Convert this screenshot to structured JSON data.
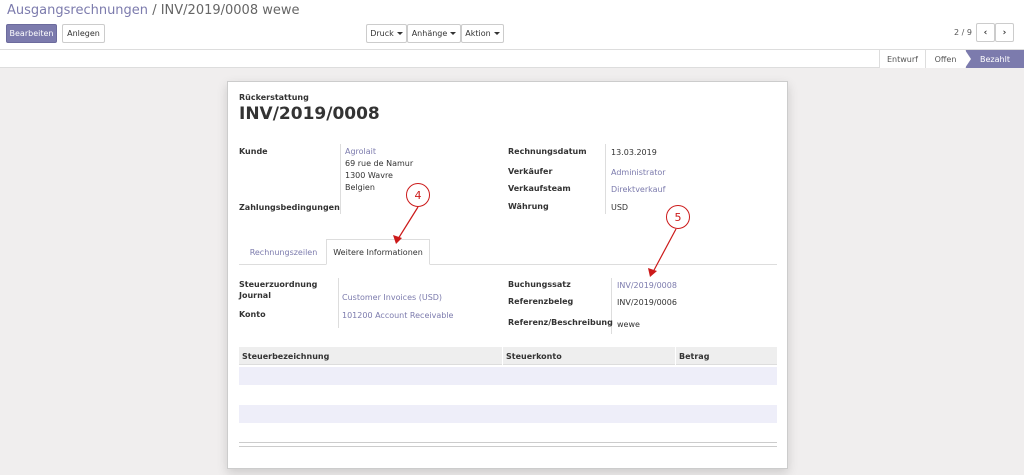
{
  "breadcrumb": {
    "parent": "Ausgangsrechnungen",
    "separator": "/",
    "current": "INV/2019/0008 wewe"
  },
  "toolbar": {
    "edit_label": "Bearbeiten",
    "create_label": "Anlegen",
    "print_label": "Druck",
    "attachments_label": "Anhänge",
    "action_label": "Aktion"
  },
  "pager": {
    "value": "2 / 9"
  },
  "statusbar": {
    "stages": [
      "Entwurf",
      "Offen",
      "Bezahlt"
    ],
    "active": "Bezahlt"
  },
  "sheet": {
    "type_label": "Rückerstattung",
    "number": "INV/2019/0008",
    "left_fields": {
      "customer_label": "Kunde",
      "customer_name": "Agrolait",
      "address_line1": "69 rue de Namur",
      "address_line2": "1300 Wavre",
      "address_line3": "Belgien",
      "payment_terms_label": "Zahlungsbedingungen"
    },
    "right_fields": {
      "invoice_date_label": "Rechnungsdatum",
      "invoice_date": "13.03.2019",
      "salesperson_label": "Verkäufer",
      "salesperson": "Administrator",
      "sales_team_label": "Verkaufsteam",
      "sales_team": "Direktverkauf",
      "currency_label": "Währung",
      "currency": "USD"
    },
    "tabs": [
      "Rechnungszeilen",
      "Weitere Informationen"
    ],
    "active_tab": "Weitere Informationen",
    "more_info": {
      "fiscal_position_label": "Steuerzuordnung",
      "journal_label": "Journal",
      "journal": "Customer Invoices (USD)",
      "account_label": "Konto",
      "account": "101200 Account Receivable",
      "journal_entry_label": "Buchungssatz",
      "journal_entry": "INV/2019/0008",
      "reference_label": "Referenzbeleg",
      "reference": "INV/2019/0006",
      "reference_desc_label": "Referenz/Beschreibung",
      "reference_desc": "wewe"
    },
    "tax_table": {
      "columns": [
        "Steuerbezeichnung",
        "Steuerkonto",
        "Betrag"
      ]
    }
  },
  "annotations": {
    "marker_4": "4",
    "marker_5": "5",
    "color": "#cc1a1a"
  }
}
